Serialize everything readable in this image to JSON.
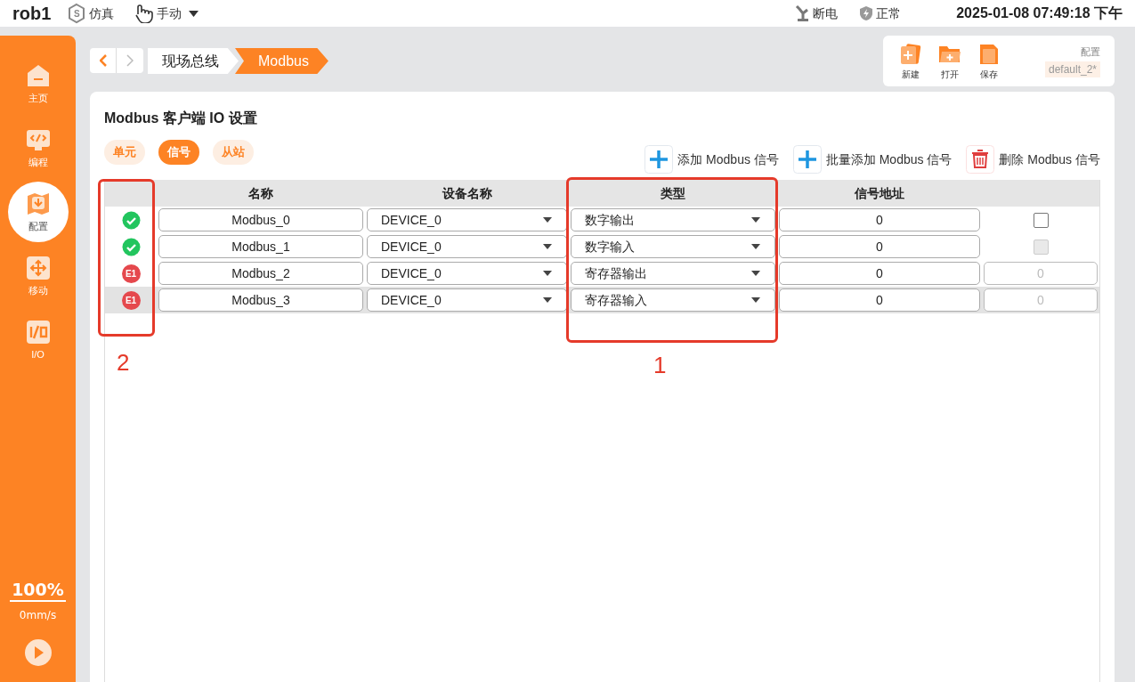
{
  "top_bar": {
    "robot": "rob1",
    "mode_badge": "S",
    "mode": "仿真",
    "control": "手动",
    "power": "断电",
    "safety": "正常",
    "datetime": "2025-01-08 07:49:18 下午"
  },
  "sidebar": {
    "items": [
      {
        "label": "主页",
        "selected": false
      },
      {
        "label": "编程",
        "selected": false
      },
      {
        "label": "配置",
        "selected": true
      },
      {
        "label": "移动",
        "selected": false
      },
      {
        "label": "I/O",
        "selected": false
      }
    ],
    "speed_percent": "100%",
    "speed": "0mm/s"
  },
  "breadcrumb": [
    "现场总线",
    "Modbus"
  ],
  "file_panel": {
    "buttons": [
      {
        "label": "新建"
      },
      {
        "label": "打开"
      },
      {
        "label": "保存"
      }
    ],
    "config_label": "配置",
    "config_name": "default_2*"
  },
  "page_title": "Modbus 客户端 IO 设置",
  "tabs": [
    {
      "label": "单元",
      "selected": false
    },
    {
      "label": "信号",
      "selected": true
    },
    {
      "label": "从站",
      "selected": false
    }
  ],
  "actions": [
    {
      "label": "添加 Modbus 信号",
      "kind": "add"
    },
    {
      "label": "批量添加 Modbus 信号",
      "kind": "add"
    },
    {
      "label": "删除 Modbus 信号",
      "kind": "delete"
    }
  ],
  "table": {
    "columns": [
      "名称",
      "设备名称",
      "类型",
      "信号地址"
    ],
    "rows": [
      {
        "kind": "ok",
        "name": "Modbus_0",
        "device": "DEVICE_0",
        "type": "数字输出",
        "address": "0",
        "extra": {
          "kind": "checkbox",
          "checked": false,
          "disabled": false
        },
        "selected": false
      },
      {
        "kind": "ok",
        "name": "Modbus_1",
        "device": "DEVICE_0",
        "type": "数字输入",
        "address": "0",
        "extra": {
          "kind": "checkbox",
          "checked": false,
          "disabled": true
        },
        "selected": false
      },
      {
        "kind": "error",
        "code": "E1",
        "name": "Modbus_2",
        "device": "DEVICE_0",
        "type": "寄存器输出",
        "address": "0",
        "extra": {
          "kind": "field",
          "value": "0"
        },
        "selected": false
      },
      {
        "kind": "error",
        "code": "E1",
        "name": "Modbus_3",
        "device": "DEVICE_0",
        "type": "寄存器输入",
        "address": "0",
        "extra": {
          "kind": "field",
          "value": "0"
        },
        "selected": true
      }
    ]
  },
  "annotations": [
    {
      "label": "2"
    },
    {
      "label": "1"
    }
  ]
}
